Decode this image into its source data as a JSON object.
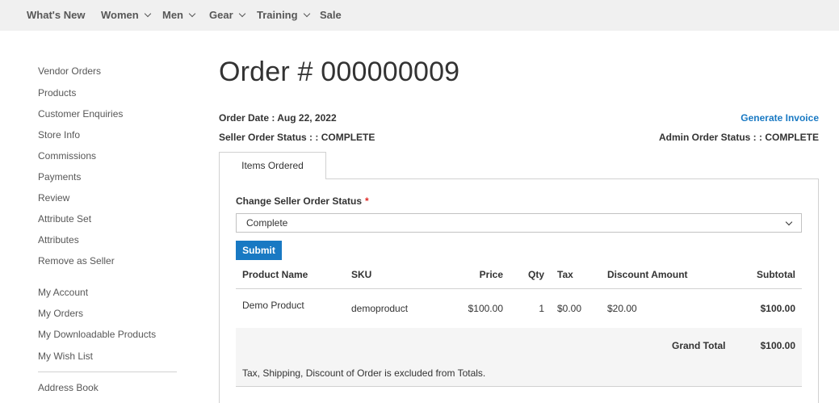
{
  "nav": {
    "items": [
      {
        "label": "What's New",
        "has_menu": false
      },
      {
        "label": "Women",
        "has_menu": true
      },
      {
        "label": "Men",
        "has_menu": true
      },
      {
        "label": "Gear",
        "has_menu": true
      },
      {
        "label": "Training",
        "has_menu": true
      },
      {
        "label": "Sale",
        "has_menu": false
      }
    ]
  },
  "sidebar": {
    "items": [
      "Vendor Orders",
      "Products",
      "Customer Enquiries",
      "Store Info",
      "Commissions",
      "Payments",
      "Review",
      "Attribute Set",
      "Attributes",
      "Remove as Seller",
      "My Account",
      "My Orders",
      "My Downloadable Products",
      "My Wish List",
      "Address Book"
    ]
  },
  "order": {
    "title": "Order # 000000009",
    "date_line": "Order Date : Aug 22, 2022",
    "seller_status_line": "Seller Order Status : : COMPLETE",
    "admin_status_line": "Admin Order Status : : COMPLETE",
    "generate_invoice": "Generate Invoice"
  },
  "tabs": {
    "items_ordered": "Items Ordered"
  },
  "status_form": {
    "label": "Change Seller Order Status",
    "required_mark": "*",
    "selected": "Complete",
    "submit": "Submit"
  },
  "table": {
    "headers": {
      "product_name": "Product Name",
      "sku": "SKU",
      "price": "Price",
      "qty": "Qty",
      "tax": "Tax",
      "discount": "Discount Amount",
      "subtotal": "Subtotal"
    },
    "rows": [
      {
        "product_name": "Demo Product",
        "sku": "demoproduct",
        "price": "$100.00",
        "qty": "1",
        "tax": "$0.00",
        "discount": "$20.00",
        "subtotal": "$100.00"
      }
    ],
    "grand_total_label": "Grand Total",
    "grand_total_value": "$100.00",
    "note": "Tax, Shipping, Discount of Order is excluded from Totals."
  },
  "colors": {
    "accent": "#1979c3",
    "nav_bg": "#f0f0f0",
    "required": "#e02b27"
  }
}
